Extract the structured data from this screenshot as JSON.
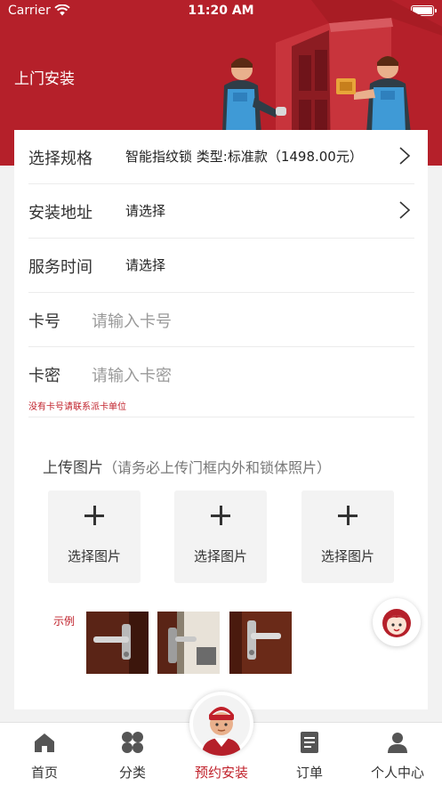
{
  "status_bar": {
    "carrier": "Carrier",
    "time": "11:20 AM"
  },
  "header": {
    "title": "上门安装"
  },
  "form": {
    "spec": {
      "label": "选择规格",
      "value": "智能指纹锁 类型:标准款（1498.00元）"
    },
    "address": {
      "label": "安装地址",
      "value": "请选择"
    },
    "service_time": {
      "label": "服务时间",
      "value": "请选择"
    },
    "card_number": {
      "label": "卡号",
      "placeholder": "请输入卡号",
      "value": ""
    },
    "card_password": {
      "label": "卡密",
      "placeholder": "请输入卡密",
      "value": ""
    },
    "hint": "没有卡号请联系派卡单位"
  },
  "upload": {
    "title": "上传图片",
    "subtitle": "（请务必上传门框内外和锁体照片）",
    "slots": [
      {
        "label": "选择图片"
      },
      {
        "label": "选择图片"
      },
      {
        "label": "选择图片"
      }
    ],
    "example_label": "示例"
  },
  "tabbar": {
    "tabs": [
      {
        "label": "首页",
        "icon": "home-icon"
      },
      {
        "label": "分类",
        "icon": "category-icon"
      },
      {
        "label": "预约安装",
        "icon": "technician-avatar",
        "active": true
      },
      {
        "label": "订单",
        "icon": "order-icon"
      },
      {
        "label": "个人中心",
        "icon": "profile-icon"
      }
    ]
  },
  "colors": {
    "brand": "#b5202a",
    "accent_text": "#c0202a",
    "page_bg": "#f2f2f2"
  }
}
